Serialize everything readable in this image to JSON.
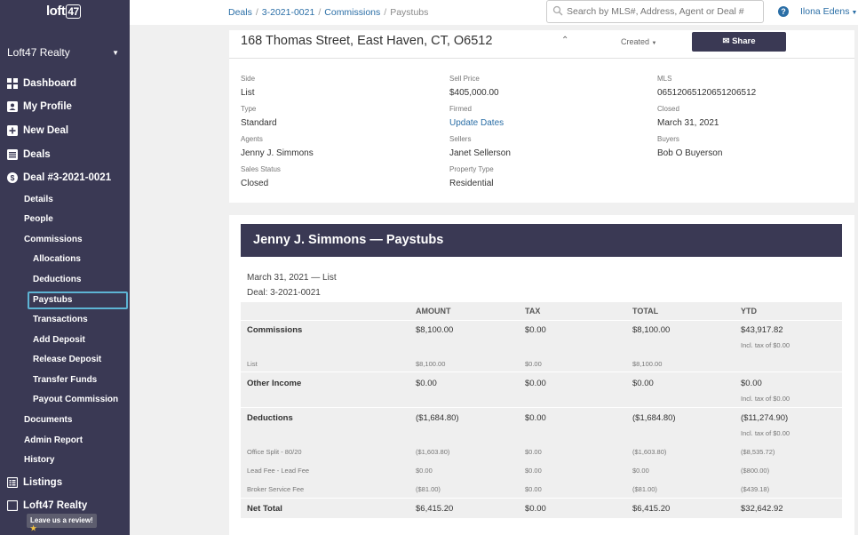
{
  "sidebar": {
    "logo_text": "loft",
    "logo_num": "47",
    "org_name": "Loft47 Realty",
    "main_items": [
      {
        "label": "Dashboard"
      },
      {
        "label": "My Profile"
      },
      {
        "label": "New Deal"
      },
      {
        "label": "Deals"
      },
      {
        "label": "Deal #3-2021-0021"
      }
    ],
    "deal_items": [
      {
        "label": "Details"
      },
      {
        "label": "People"
      },
      {
        "label": "Commissions"
      }
    ],
    "commission_items": [
      {
        "label": "Allocations"
      },
      {
        "label": "Deductions"
      },
      {
        "label": "Paystubs"
      },
      {
        "label": "Transactions"
      },
      {
        "label": "Add Deposit"
      },
      {
        "label": "Release Deposit"
      },
      {
        "label": "Transfer Funds"
      },
      {
        "label": "Payout Commission"
      }
    ],
    "deal_items_after": [
      {
        "label": "Documents"
      },
      {
        "label": "Admin Report"
      },
      {
        "label": "History"
      }
    ],
    "listings_label": "Listings",
    "next_org_label": "Loft47 Realty",
    "review_label": "Leave us a review!"
  },
  "topbar": {
    "breadcrumb": [
      "Deals",
      "3-2021-0021",
      "Commissions",
      "Paystubs"
    ],
    "search_placeholder": "Search by MLS#, Address, Agent or Deal #",
    "help_label": "?",
    "user_name": "Ilona Edens"
  },
  "deal": {
    "address": "168 Thomas Street, East Haven, CT, O6512",
    "created_label": "Created",
    "share_label": "Share",
    "fields": {
      "side_label": "Side",
      "side": "List",
      "sell_price_label": "Sell Price",
      "sell_price": "$405,000.00",
      "mls_label": "MLS",
      "mls": "06512065120651206512",
      "type_label": "Type",
      "type": "Standard",
      "firmed_label": "Firmed",
      "firmed": "Update Dates",
      "closed_label": "Closed",
      "closed": "March 31, 2021",
      "agents_label": "Agents",
      "agents": "Jenny J. Simmons",
      "sellers_label": "Sellers",
      "sellers": "Janet Sellerson",
      "buyers_label": "Buyers",
      "buyers": "Bob O Buyerson",
      "status_label": "Sales Status",
      "status": "Closed",
      "property_label": "Property Type",
      "property": "Residential"
    }
  },
  "paystub": {
    "title": "Jenny J. Simmons — Paystubs",
    "date_line": "March 31, 2021 — List",
    "deal_line": "Deal: 3-2021-0021",
    "headers": [
      "AMOUNT",
      "TAX",
      "TOTAL",
      "YTD"
    ],
    "commissions": {
      "label": "Commissions",
      "amount": "$8,100.00",
      "tax": "$0.00",
      "total": "$8,100.00",
      "ytd": "$43,917.82",
      "ytd_note": "Incl. tax of $0.00"
    },
    "commissions_list": {
      "label": "List",
      "amount": "$8,100.00",
      "tax": "$0.00",
      "total": "$8,100.00"
    },
    "other_income": {
      "label": "Other Income",
      "amount": "$0.00",
      "tax": "$0.00",
      "total": "$0.00",
      "ytd": "$0.00",
      "ytd_note": "Incl. tax of $0.00"
    },
    "deductions": {
      "label": "Deductions",
      "amount": "($1,684.80)",
      "tax": "$0.00",
      "total": "($1,684.80)",
      "ytd": "($11,274.90)",
      "ytd_note": "Incl. tax of $0.00"
    },
    "deduction_lines": [
      {
        "label": "Office Split - 80/20",
        "amount": "($1,603.80)",
        "tax": "$0.00",
        "total": "($1,603.80)",
        "ytd": "($8,535.72)"
      },
      {
        "label": "Lead Fee - Lead Fee",
        "amount": "$0.00",
        "tax": "$0.00",
        "total": "$0.00",
        "ytd": "($800.00)"
      },
      {
        "label": "Broker Service Fee",
        "amount": "($81.00)",
        "tax": "$0.00",
        "total": "($81.00)",
        "ytd": "($439.18)"
      }
    ],
    "net_total": {
      "label": "Net Total",
      "amount": "$6,415.20",
      "tax": "$0.00",
      "total": "$6,415.20",
      "ytd": "$32,642.92"
    }
  },
  "colors": {
    "sidebar": "#3a3954",
    "accent": "#2a6ea6",
    "highlight": "#5db4d4"
  }
}
